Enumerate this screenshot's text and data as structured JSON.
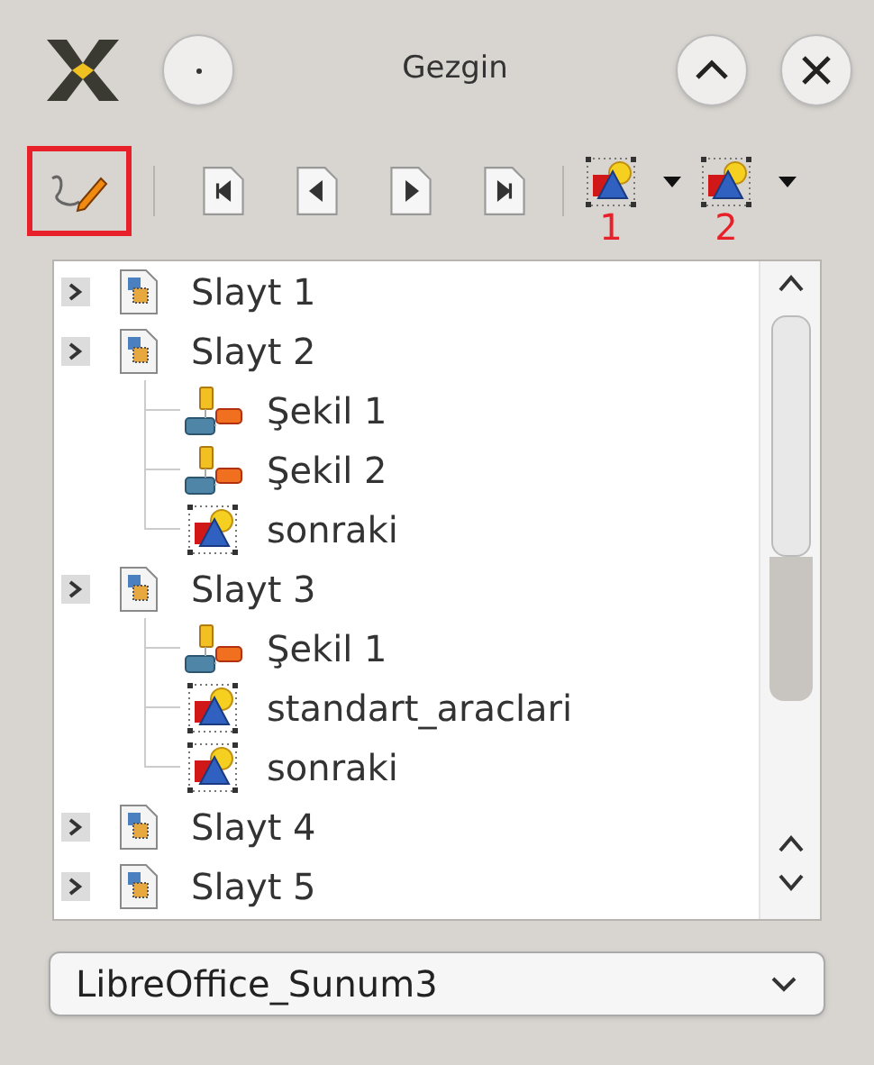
{
  "window": {
    "title": "Gezgin"
  },
  "toolbar": [
    {
      "kind": "pen",
      "highlighted": true
    },
    {
      "kind": "first"
    },
    {
      "kind": "previous"
    },
    {
      "kind": "next"
    },
    {
      "kind": "last"
    },
    {
      "kind": "object",
      "callout": "1"
    },
    {
      "kind": "object",
      "callout": "2"
    }
  ],
  "tree": [
    {
      "label": "Slayt 1"
    },
    {
      "label": "Slayt 2",
      "children": [
        {
          "label": "Şekil 1",
          "kind": "shape"
        },
        {
          "label": "Şekil 2",
          "kind": "shape"
        },
        {
          "label": "sonraki",
          "kind": "object"
        }
      ]
    },
    {
      "label": "Slayt 3",
      "children": [
        {
          "label": "Şekil 1",
          "kind": "shape"
        },
        {
          "label": "standart_araclari",
          "kind": "object"
        },
        {
          "label": "sonraki",
          "kind": "object"
        }
      ]
    },
    {
      "label": "Slayt 4"
    },
    {
      "label": "Slayt 5"
    }
  ],
  "document_select": {
    "value": "LibreOffice_Sunum3"
  }
}
